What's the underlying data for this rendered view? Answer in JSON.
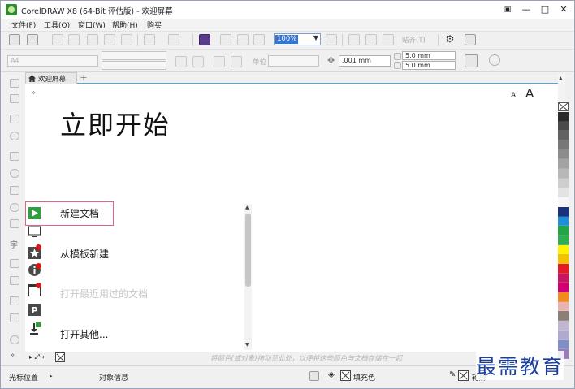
{
  "window": {
    "title": "CorelDRAW X8 (64-Bit 评估版) - 欢迎屏幕",
    "minimize": "—",
    "maximize": "□",
    "close": "✕"
  },
  "menu": {
    "items": [
      "文件(F)",
      "工具(O)",
      "窗口(W)",
      "帮助(H)",
      "购买"
    ]
  },
  "toolbar": {
    "zoom_value": "100%",
    "snap_label": "贴齐(T)"
  },
  "property_bar": {
    "page_size": "A4",
    "units_label": "单位",
    "nudge_value": ".001 mm",
    "dup_x": "5.0 mm",
    "dup_y": "5.0 mm"
  },
  "tabs": {
    "welcome_tab": "欢迎屏幕",
    "add": "+"
  },
  "welcome": {
    "font_small": "A",
    "font_large": "A",
    "heading": "立即开始",
    "collapse": "»",
    "items": [
      {
        "label": "新建文档",
        "selected": true,
        "disabled": false
      },
      {
        "label": "从模板新建",
        "selected": false,
        "disabled": false
      },
      {
        "label": "打开最近用过的文档",
        "selected": false,
        "disabled": true
      },
      {
        "label": "打开其他...",
        "selected": false,
        "disabled": false
      }
    ]
  },
  "hint_bar": {
    "text": "将颜色(或对象)拖动至此处，以便将这些颜色与文档存储在一起"
  },
  "status": {
    "cursor_position": "光标位置",
    "object_info": "对象信息",
    "fill_label": "填充色",
    "outline_label": "轮廓"
  },
  "palette": {
    "colors": [
      "#2a2a2a",
      "#4a4a4a",
      "#616161",
      "#777777",
      "#8c8c8c",
      "#a3a3a3",
      "#b8b8b8",
      "#cecece",
      "#e3e3e3",
      "#f7f7f7",
      "#18327e",
      "#1f8fd6",
      "#22a546",
      "#2fad52",
      "#fff100",
      "#f2c100",
      "#e51a28",
      "#c71463",
      "#d2006e",
      "#f08b1d",
      "#e8b4b0",
      "#8b7f76",
      "#bfb6d0",
      "#b0aad0",
      "#7f8fc6",
      "#9a7bb8"
    ]
  },
  "watermark": {
    "text": "最需教育"
  }
}
